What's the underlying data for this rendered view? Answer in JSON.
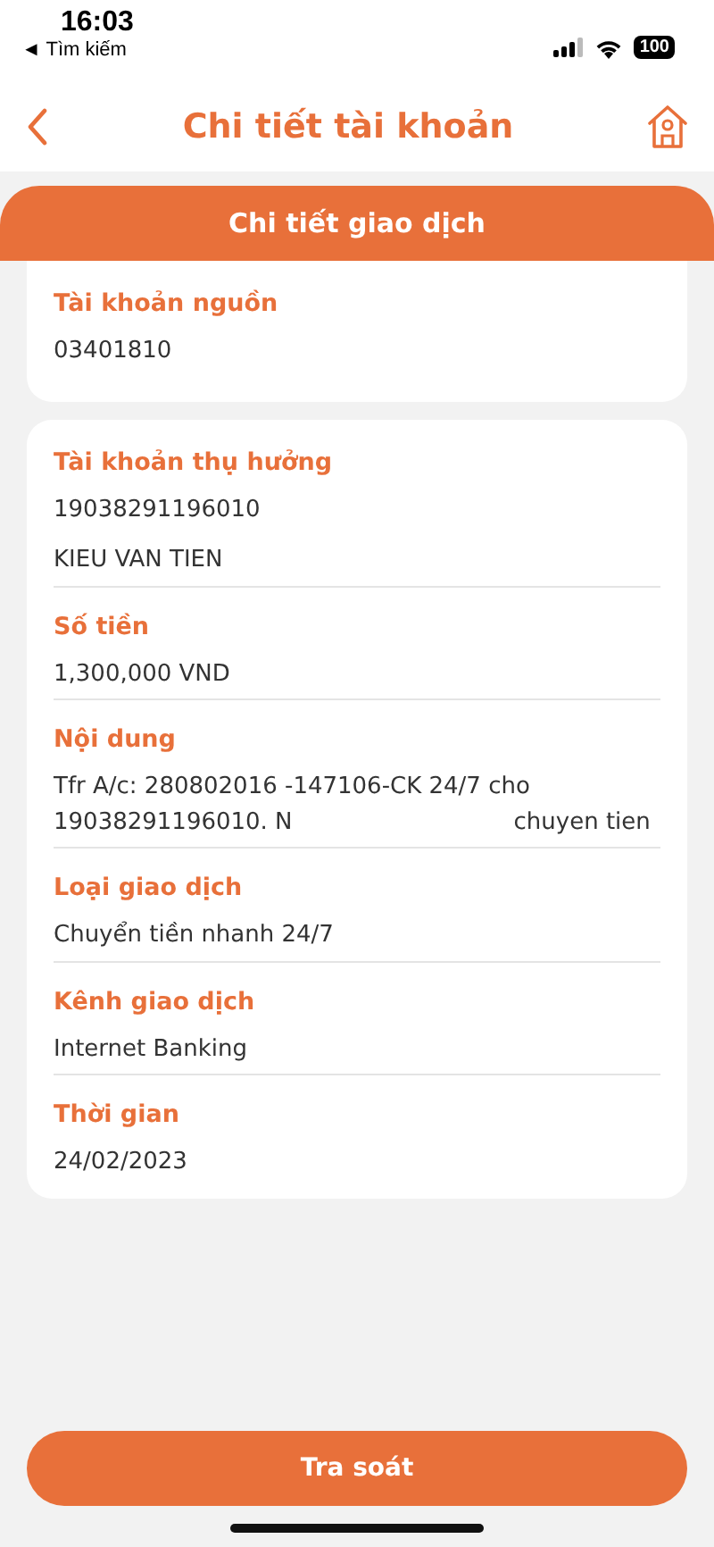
{
  "status_bar": {
    "time": "16:03",
    "back_label": "◄ Tìm kiếm",
    "battery": "100"
  },
  "header": {
    "title": "Chi tiết tài khoản"
  },
  "banner": {
    "title": "Chi tiết giao dịch"
  },
  "source": {
    "label": "Tài khoản nguồn",
    "value": "03401810"
  },
  "details": [
    {
      "label": "Tài khoản thụ hưởng",
      "values": [
        "19038291196010",
        "KIEU VAN TIEN"
      ]
    },
    {
      "label": "Số tiền",
      "values": [
        "1,300,000 VND"
      ]
    },
    {
      "label": "Nội dung",
      "values": [
        "Tfr A/c: 280802016 -147106-CK 24/7 cho 19038291196010. N                              chuyen tien"
      ]
    },
    {
      "label": "Loại giao dịch",
      "values": [
        "Chuyển tiền nhanh 24/7"
      ]
    },
    {
      "label": "Kênh giao dịch",
      "values": [
        "Internet Banking"
      ]
    },
    {
      "label": "Thời gian",
      "values": [
        "24/02/2023"
      ]
    }
  ],
  "action_button": "Tra soát"
}
